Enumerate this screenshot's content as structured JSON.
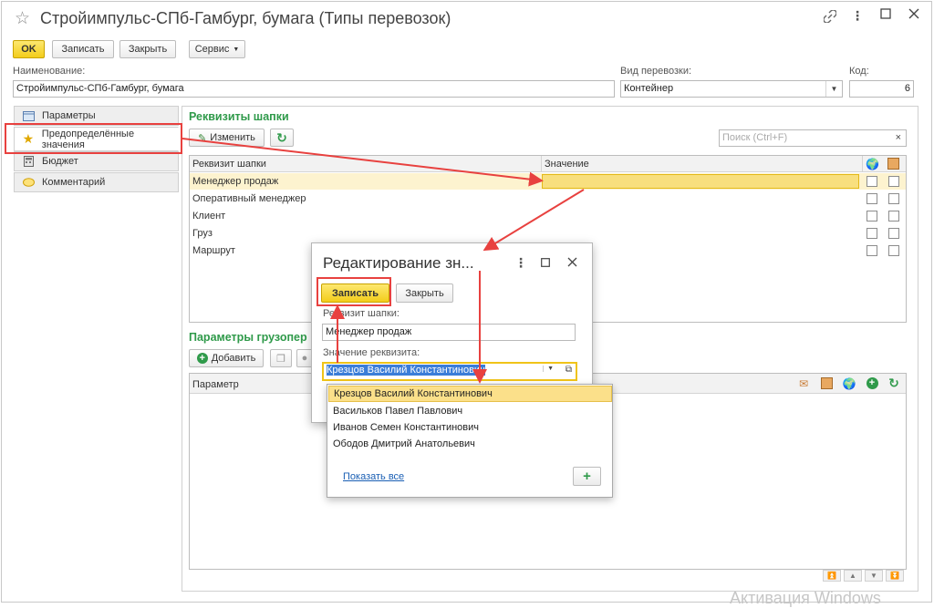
{
  "window": {
    "title": "Стройимпульс-СПб-Гамбург, бумага (Типы перевозок)"
  },
  "toolbar": {
    "ok_label": "OK",
    "save_label": "Записать",
    "close_label": "Закрыть",
    "service_label": "Сервис"
  },
  "fields": {
    "name_label": "Наименование:",
    "name_value": "Стройимпульс-СПб-Гамбург, бумага",
    "transport_label": "Вид перевозки:",
    "transport_value": "Контейнер",
    "code_label": "Код:",
    "code_value": "6"
  },
  "tabs": [
    {
      "label": "Параметры",
      "icon": "parameters-icon"
    },
    {
      "label": "Предопределённые значения",
      "icon": "magic-wand-icon"
    },
    {
      "label": "Бюджет",
      "icon": "calculator-icon"
    },
    {
      "label": "Комментарий",
      "icon": "speech-bubble-icon"
    }
  ],
  "header_props": {
    "title": "Реквизиты шапки",
    "edit_label": "Изменить",
    "search_placeholder": "Поиск (Ctrl+F)",
    "col_attr": "Реквизит шапки",
    "col_value": "Значение",
    "rows": [
      {
        "attr": "Менеджер продаж",
        "value": ""
      },
      {
        "attr": "Оперативный менеджер",
        "value": ""
      },
      {
        "attr": "Клиент",
        "value": ""
      },
      {
        "attr": "Груз",
        "value": ""
      },
      {
        "attr": "Маршрут",
        "value": ""
      }
    ]
  },
  "cargo_params": {
    "title": "Параметры грузопер",
    "add_label": "Добавить",
    "col_param": "Параметр"
  },
  "modal": {
    "title": "Редактирование зн...",
    "save_label": "Записать",
    "close_label": "Закрыть",
    "attr_label": "Реквизит шапки:",
    "attr_value": "Менеджер продаж",
    "value_label": "Значение реквизита:",
    "value_text": "Крезцов Василий Константинович"
  },
  "dropdown": {
    "options": [
      "Крезцов Василий Константинович",
      "Васильков Павел Павлович",
      "Иванов Семен Константинович",
      "Ободов Дмитрий Анатольевич"
    ],
    "selected_index": 0,
    "show_all_label": "Показать все"
  },
  "watermark": "Активация Windows",
  "colors": {
    "accent_green": "#2f9a4a",
    "primary_yellow": "#f3cd1b",
    "annotation_red": "#e8413f"
  }
}
